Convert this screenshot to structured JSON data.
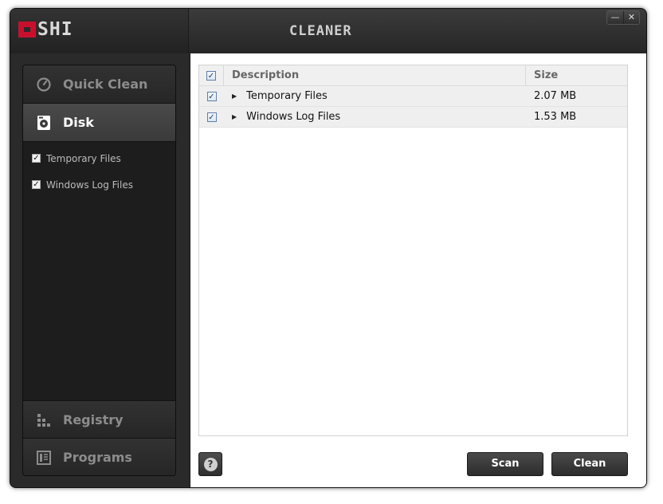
{
  "app": {
    "logo_text": "SHI",
    "title": "CLEANER"
  },
  "window_controls": {
    "minimize": "—",
    "close": "✕"
  },
  "sidebar": {
    "items": [
      {
        "label": "Quick Clean",
        "icon": "gauge-icon",
        "active": false
      },
      {
        "label": "Disk",
        "icon": "disk-icon",
        "active": true
      },
      {
        "label": "Registry",
        "icon": "registry-icon",
        "active": false
      },
      {
        "label": "Programs",
        "icon": "programs-icon",
        "active": false
      }
    ],
    "disk_options": [
      {
        "label": "Temporary Files",
        "checked": true
      },
      {
        "label": "Windows Log Files",
        "checked": true
      }
    ]
  },
  "table": {
    "columns": [
      "Description",
      "Size"
    ],
    "rows": [
      {
        "description": "Temporary Files",
        "size": "2.07 MB",
        "checked": true
      },
      {
        "description": "Windows Log Files",
        "size": "1.53 MB",
        "checked": true
      }
    ]
  },
  "footer": {
    "help": "?",
    "scan_label": "Scan",
    "clean_label": "Clean"
  },
  "colors": {
    "brand_red": "#c8102e",
    "dark_bg": "#2a2a2a"
  }
}
